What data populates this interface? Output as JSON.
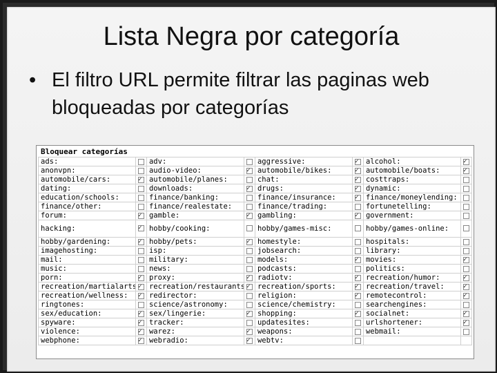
{
  "slide": {
    "title": "Lista Negra por categoría",
    "bullet_symbol": "•",
    "bullet_text": "El filtro URL permite filtrar las paginas web bloqueadas por categorías"
  },
  "panel": {
    "title": "Bloquear categorías",
    "rows": [
      [
        [
          "ads:",
          false
        ],
        [
          "adv:",
          false
        ],
        [
          "aggressive:",
          true
        ],
        [
          "alcohol:",
          true
        ]
      ],
      [
        [
          "anonvpn:",
          false
        ],
        [
          "audio-video:",
          true
        ],
        [
          "automobile/bikes:",
          true
        ],
        [
          "automobile/boats:",
          true
        ]
      ],
      [
        [
          "automobile/cars:",
          true
        ],
        [
          "automobile/planes:",
          false
        ],
        [
          "chat:",
          true
        ],
        [
          "costtraps:",
          false
        ]
      ],
      [
        [
          "dating:",
          false
        ],
        [
          "downloads:",
          true
        ],
        [
          "drugs:",
          true
        ],
        [
          "dynamic:",
          false
        ]
      ],
      [
        [
          "education/schools:",
          false
        ],
        [
          "finance/banking:",
          false
        ],
        [
          "finance/insurance:",
          true
        ],
        [
          "finance/moneylending:",
          false
        ]
      ],
      [
        [
          "finance/other:",
          false
        ],
        [
          "finance/realestate:",
          false
        ],
        [
          "finance/trading:",
          false
        ],
        [
          "fortunetelling:",
          false
        ]
      ],
      [
        [
          "forum:",
          true
        ],
        [
          "gamble:",
          true
        ],
        [
          "gambling:",
          true
        ],
        [
          "government:",
          false
        ]
      ],
      [
        [
          "hacking:",
          true
        ],
        [
          "hobby/cooking:",
          false
        ],
        [
          "hobby/games-misc:",
          false
        ],
        [
          "hobby/games-online:",
          false
        ]
      ],
      [
        [
          "hobby/gardening:",
          true
        ],
        [
          "hobby/pets:",
          true
        ],
        [
          "homestyle:",
          false
        ],
        [
          "hospitals:",
          false
        ]
      ],
      [
        [
          "imagehosting:",
          false
        ],
        [
          "isp:",
          false
        ],
        [
          "jobsearch:",
          false
        ],
        [
          "library:",
          false
        ]
      ],
      [
        [
          "mail:",
          false
        ],
        [
          "military:",
          false
        ],
        [
          "models:",
          true
        ],
        [
          "movies:",
          true
        ]
      ],
      [
        [
          "music:",
          false
        ],
        [
          "news:",
          false
        ],
        [
          "podcasts:",
          false
        ],
        [
          "politics:",
          false
        ]
      ],
      [
        [
          "porn:",
          true
        ],
        [
          "proxy:",
          true
        ],
        [
          "radiotv:",
          true
        ],
        [
          "recreation/humor:",
          true
        ]
      ],
      [
        [
          "recreation/martialarts:",
          true
        ],
        [
          "recreation/restaurants:",
          true
        ],
        [
          "recreation/sports:",
          true
        ],
        [
          "recreation/travel:",
          true
        ]
      ],
      [
        [
          "recreation/wellness:",
          true
        ],
        [
          "redirector:",
          false
        ],
        [
          "religion:",
          true
        ],
        [
          "remotecontrol:",
          true
        ]
      ],
      [
        [
          "ringtones:",
          false
        ],
        [
          "science/astronomy:",
          false
        ],
        [
          "science/chemistry:",
          false
        ],
        [
          "searchengines:",
          false
        ]
      ],
      [
        [
          "sex/education:",
          true
        ],
        [
          "sex/lingerie:",
          true
        ],
        [
          "shopping:",
          true
        ],
        [
          "socialnet:",
          true
        ]
      ],
      [
        [
          "spyware:",
          true
        ],
        [
          "tracker:",
          false
        ],
        [
          "updatesites:",
          false
        ],
        [
          "urlshortener:",
          true
        ]
      ],
      [
        [
          "violence:",
          true
        ],
        [
          "warez:",
          true
        ],
        [
          "weapons:",
          false
        ],
        [
          "webmail:",
          false
        ]
      ],
      [
        [
          "webphone:",
          true
        ],
        [
          "webradio:",
          true
        ],
        [
          "webtv:",
          false
        ],
        [
          "",
          false
        ]
      ]
    ]
  }
}
